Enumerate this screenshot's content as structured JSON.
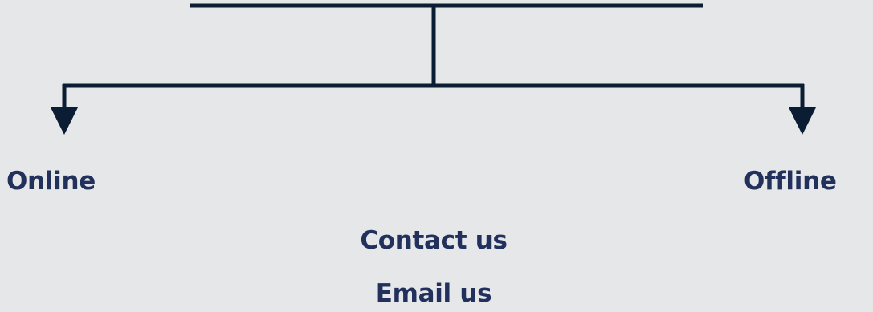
{
  "colors": {
    "background": "#e6e7e9",
    "connector": "#0b1d33",
    "text": "#22305c"
  },
  "diagram": {
    "left_branch": {
      "label": "Online"
    },
    "right_branch": {
      "label": "Offline"
    },
    "center_items": [
      {
        "label": "Contact us"
      },
      {
        "label": "Email us"
      }
    ]
  }
}
